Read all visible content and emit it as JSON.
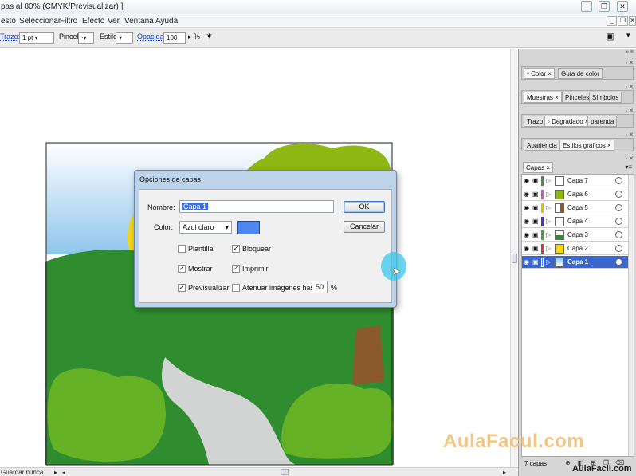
{
  "window": {
    "title": "pas al 80% (CMYK/Previsualizar) ]",
    "controls": {
      "minimize": "_",
      "restore": "❐",
      "close": "✕"
    }
  },
  "menu": [
    "esto",
    "Seleccionar",
    "Filtro",
    "Efecto",
    "Ver",
    "Ventana",
    "Ayuda"
  ],
  "control_bar": {
    "stroke_label": "Trazo:",
    "stroke_value": "1 pt",
    "brush_label": "Pincel:",
    "brush_value": "·",
    "style_label": "Estilo:",
    "opacity_label": "Opacidad:",
    "opacity_value": "100",
    "opacity_unit": "%"
  },
  "dialog": {
    "title": "Opciones de capas",
    "name_label": "Nombre:",
    "name_value": "Capa 1",
    "color_label": "Color:",
    "color_value": "Azul claro",
    "color_swatch": "#4f87f2",
    "ok_label": "OK",
    "cancel_label": "Cancelar",
    "options": {
      "template": {
        "label": "Plantilla",
        "checked": false
      },
      "lock": {
        "label": "Bloquear",
        "checked": true
      },
      "show": {
        "label": "Mostrar",
        "checked": true
      },
      "print": {
        "label": "Imprimir",
        "checked": true
      },
      "preview": {
        "label": "Previsualizar",
        "checked": true
      },
      "dim": {
        "label": "Atenuar imágenes hasta:",
        "checked": false,
        "value": "50",
        "unit": "%"
      }
    }
  },
  "panels": {
    "row1": [
      "Color",
      "Guía de color"
    ],
    "row2": [
      "Muestras",
      "Pinceles",
      "Símbolos"
    ],
    "row3": [
      "Trazo",
      "Degradado",
      "parenda"
    ],
    "row4": [
      "Apariencia",
      "Estilos gráficos"
    ],
    "row5": [
      "Capas"
    ],
    "close_mark": "×"
  },
  "layers": [
    {
      "name": "Capa 7",
      "color": "#4f8a4f",
      "selected": false
    },
    {
      "name": "Capa 6",
      "color": "#d14fd1",
      "selected": false
    },
    {
      "name": "Capa 5",
      "color": "#e0c000",
      "selected": false
    },
    {
      "name": "Capa 4",
      "color": "#3c3cd0",
      "selected": false
    },
    {
      "name": "Capa 3",
      "color": "#3fa83f",
      "selected": false
    },
    {
      "name": "Capa 2",
      "color": "#d03c3c",
      "selected": false
    },
    {
      "name": "Capa 1",
      "color": "#4f87f2",
      "selected": true
    }
  ],
  "layers_footer": {
    "count": "7 capas"
  },
  "status": {
    "text": "Guardar nunca"
  },
  "watermark": {
    "main": "AulaFacul.com",
    "corner": "AulaFacil.com"
  }
}
